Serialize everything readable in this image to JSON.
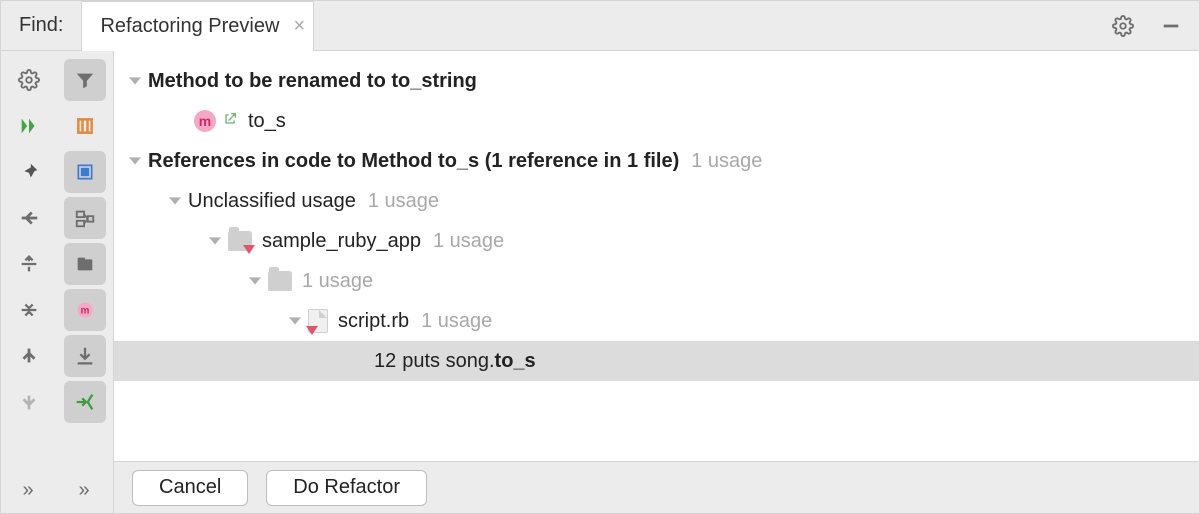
{
  "header": {
    "find_label": "Find:",
    "tab_title": "Refactoring Preview"
  },
  "tree": {
    "heading1_prefix": "Method to be renamed to ",
    "heading1_target": "to_string",
    "method_name": "to_s",
    "heading2_main": "References in code to Method to_s (1 reference in 1 file)",
    "heading2_usage": "1 usage",
    "unclassified_label": "Unclassified usage",
    "unclassified_usage": "1 usage",
    "project_name": "sample_ruby_app",
    "project_usage": "1 usage",
    "folder_usage": "1 usage",
    "file_name": "script.rb",
    "file_usage": "1 usage",
    "result_line": "12",
    "result_code_prefix": "puts song.",
    "result_code_bold": "to_s"
  },
  "footer": {
    "cancel_label": "Cancel",
    "do_refactor_label": "Do Refactor"
  }
}
